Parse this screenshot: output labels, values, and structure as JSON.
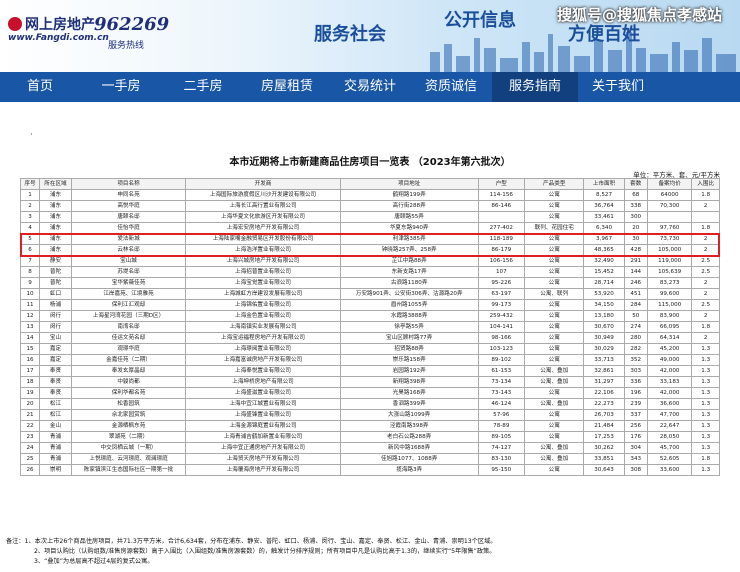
{
  "header": {
    "logo_text": "网上房地产",
    "logo_url": "www.Fangdi.com.cn",
    "hotline_number": "962269",
    "hotline_label": "服务热线",
    "slogan_service": "服务社会",
    "slogan_info": "公开信息",
    "slogan_people": "方便百姓",
    "watermark": "搜狐号@搜狐焦点孝感站"
  },
  "nav": {
    "items": [
      "首页",
      "一手房",
      "二手房",
      "房屋租赁",
      "交易统计",
      "资质诚信",
      "服务指南",
      "关于我们"
    ],
    "active_index": 6
  },
  "content": {
    "dot": "·",
    "title": "本市近期将上市新建商品住房项目一览表 （2023年第六批次）",
    "unit": "单位：平方米、套、元/平方米",
    "columns": [
      "序号",
      "所在区域",
      "项目名称",
      "开发商",
      "项目地址",
      "户型",
      "产品类型",
      "上市面积",
      "套数",
      "备案均价",
      "入围比"
    ],
    "rows": [
      [
        "1",
        "浦东",
        "申同名苑",
        "上海国际旅游度假区川沙开发建设有限公司",
        "鹤翔路199弄",
        "114-156",
        "公寓",
        "8,527",
        "68",
        "64000",
        "1.8"
      ],
      [
        "2",
        "浦东",
        "高悦华庭",
        "上海长江高行置业有限公司",
        "高行街288弄",
        "86-146",
        "公寓",
        "36,764",
        "338",
        "70,300",
        "2"
      ],
      [
        "3",
        "浦东",
        "唐颐名邸",
        "上海华夏文化旅游区开发有限公司",
        "唐颐路55弄",
        "",
        "公寓",
        "33,461",
        "300",
        "",
        ""
      ],
      [
        "4",
        "浦东",
        "佳怡华庭",
        "上海宏安房地产开发有限公司",
        "华夏东路940弄",
        "277-402",
        "联列、花园住宅",
        "6,340",
        "20",
        "97,760",
        "1.8"
      ],
      [
        "5",
        "浦东",
        "爱法新城",
        "上海陆家嘴金融贸易区开发股份有限公司",
        "利津路385弄",
        "118-189",
        "公寓",
        "3,967",
        "30",
        "73,730",
        "2"
      ],
      [
        "6",
        "浦东",
        "云林名邸",
        "上海浩洋置业有限公司",
        "钟晓路257弄、258弄",
        "86-179",
        "公寓",
        "48,365",
        "428",
        "105,000",
        "2"
      ],
      [
        "7",
        "静安",
        "宝山城",
        "上海兴城房地产开发有限公司",
        "芷江中路88弄",
        "106-156",
        "公寓",
        "32,490",
        "291",
        "119,000",
        "2.5"
      ],
      [
        "8",
        "普陀",
        "苏堤名邸",
        "上海招普置业有限公司",
        "东新支路17弄",
        "107",
        "公寓",
        "15,452",
        "144",
        "105,639",
        "2.5"
      ],
      [
        "9",
        "普陀",
        "宝华紫薇佳苑",
        "上海宝觉置业有限公司",
        "古浪路1180弄",
        "95-226",
        "公寓",
        "28,714",
        "246",
        "83,273",
        "2"
      ],
      [
        "10",
        "虹口",
        "江岸嘉苑、江境雅苑",
        "上海城虹方岸建设发展有限公司",
        "万安路901弄、公安街306弄、沽源路20弄",
        "63-197",
        "公寓、联列",
        "53,920",
        "451",
        "99,600",
        "2"
      ],
      [
        "11",
        "杨浦",
        "保利江汇观邸",
        "上海锦佑置业有限公司",
        "眉州路1055弄",
        "99-173",
        "公寓",
        "34,150",
        "284",
        "115,000",
        "2.5"
      ],
      [
        "12",
        "闵行",
        "上海星河湾花园（三期D区）",
        "上海金色置业有限公司",
        "水霞路3888弄",
        "259-432",
        "公寓",
        "13,180",
        "50",
        "83,900",
        "2"
      ],
      [
        "13",
        "闵行",
        "南湾名邸",
        "上海南镇实业发展有限公司",
        "徐亭路55弄",
        "104-141",
        "公寓",
        "30,670",
        "274",
        "66,095",
        "1.8"
      ],
      [
        "14",
        "宝山",
        "佳运文苑名邸",
        "上海宝运福程房地产开发有限公司",
        "宝山区顾村路77弄",
        "98-166",
        "公寓",
        "30,949",
        "280",
        "64,314",
        "2"
      ],
      [
        "15",
        "嘉定",
        "观璟华庭",
        "上海璟阅置业有限公司",
        "招贤路88弄",
        "103-123",
        "公寓",
        "30,029",
        "282",
        "45,200",
        "1.3"
      ],
      [
        "16",
        "嘉定",
        "金嘉佳苑（二期）",
        "上海嘉富诚房地产开发有限公司",
        "崇乐路158弄",
        "89-102",
        "公寓",
        "33,713",
        "352",
        "49,000",
        "1.3"
      ],
      [
        "17",
        "奉贤",
        "奉发玄厚晶邸",
        "上海奉悦置业有限公司",
        "岩园路192弄",
        "61-153",
        "公寓、叠加",
        "32,861",
        "303",
        "42,000",
        "1.3"
      ],
      [
        "18",
        "奉贤",
        "中骏尚都",
        "上海坤桥房地产有限公司",
        "新翔路398弄",
        "73-134",
        "公寓、叠加",
        "31,297",
        "336",
        "33,183",
        "1.3"
      ],
      [
        "19",
        "奉贤",
        "保利华都名苑",
        "上海盛滋置业有限公司",
        "光昊路168弄",
        "73-143",
        "公寓",
        "22,106",
        "196",
        "42,000",
        "1.3"
      ],
      [
        "20",
        "松江",
        "松香园筑",
        "上海中宜江城置业有限公司",
        "香泗路399弄",
        "46-124",
        "公寓、叠加",
        "22,273",
        "239",
        "36,600",
        "1.3"
      ],
      [
        "21",
        "松江",
        "佘北家园赏筑",
        "上海盛锋置业有限公司",
        "大涨山路1099弄",
        "57-96",
        "公寓",
        "26,703",
        "337",
        "47,700",
        "1.3"
      ],
      [
        "22",
        "金山",
        "金源栖枫东苑",
        "上海金源锦庭置业有限公司",
        "泾霞南路398弄",
        "78-89",
        "公寓",
        "21,484",
        "256",
        "22,647",
        "1.3"
      ],
      [
        "23",
        "青浦",
        "翠湖苑（二期）",
        "上海青浦吉鹤加新置业有限公司",
        "老白石公路288弄",
        "89-105",
        "公寓",
        "17,253",
        "176",
        "28,050",
        "1.3"
      ],
      [
        "24",
        "青浦",
        "中交凤栖云城（一期）",
        "上海中宜正通房地产开发有限公司",
        "新风中路1688弄",
        "74-127",
        "公寓、叠加",
        "30,262",
        "304",
        "45,700",
        "1.3"
      ],
      [
        "25",
        "青浦",
        "上悦璟庭、云河璟庭、观澜璟庭",
        "上海贸天房地产开发有限公司",
        "佳旭路1077、1088弄",
        "83-130",
        "公寓、叠加",
        "33,851",
        "343",
        "52,605",
        "1.8"
      ],
      [
        "26",
        "崇明",
        "陈家镇滨江生态国际社区一期第一批",
        "上海覆海房地产开发有限公司",
        "揽海路3弄",
        "95-150",
        "公寓",
        "30,643",
        "308",
        "33,600",
        "1.3"
      ]
    ]
  },
  "notes": [
    "备注：1、本次上市26个商品住房项目，共71.3万平方米，合计6,634套，分布在浦东、静安、普陀、虹口、杨浦、闵行、宝山、嘉定、奉贤、松江、金山、青浦、崇明13个区域。",
    "2、项目认购比（认购组数/准售房源套数）高于入围比（入围组数/准售房源套数）的，触发计分排序规则；所有项目中凡是认购比高于1.3的，继续实行“5年限售”政策。",
    "3、“叠加”为总层高不超过4层的复式公寓。"
  ],
  "colors": {
    "nav_bg": "#1a56a6",
    "nav_active": "#123f7d",
    "highlight": "#e02020",
    "brand_blue": "#1f2f7a"
  }
}
